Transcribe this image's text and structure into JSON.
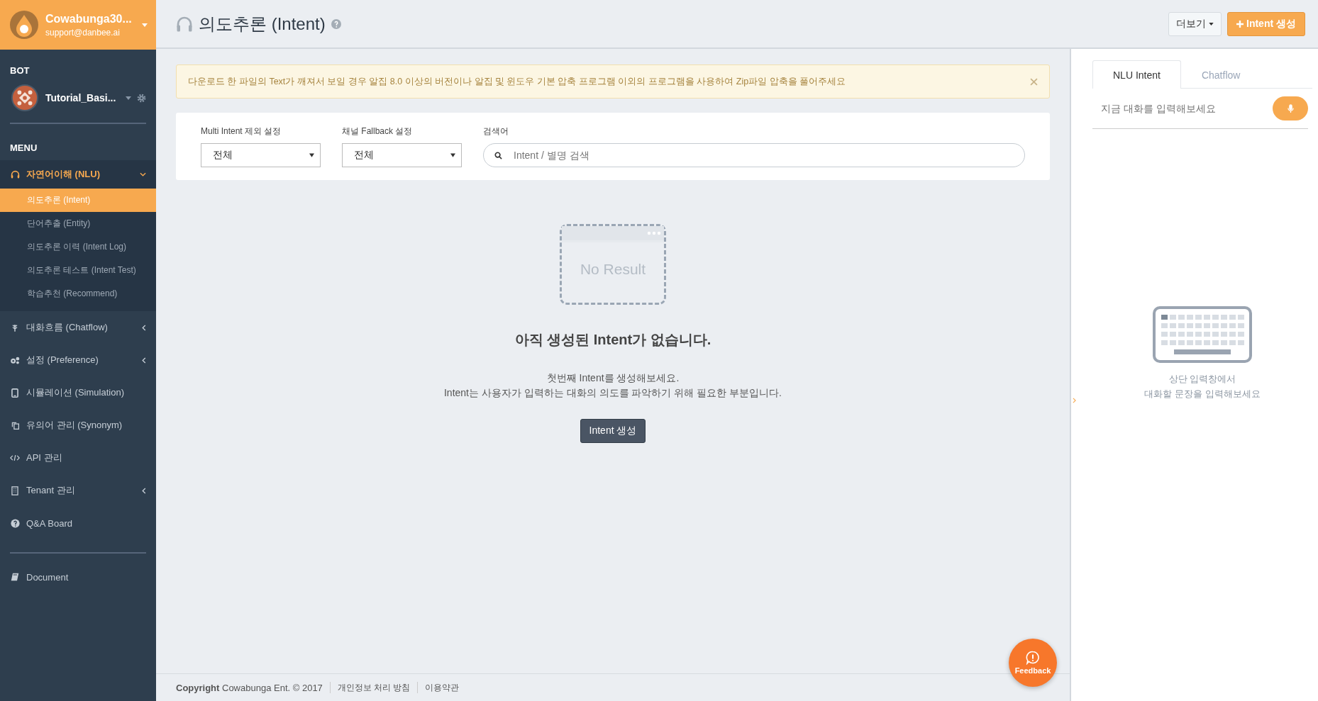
{
  "account": {
    "name": "Cowabunga30...",
    "email": "support@danbee.ai"
  },
  "bot_section": {
    "label": "BOT",
    "bot_name": "Tutorial_Basi..."
  },
  "menu": {
    "label": "MENU",
    "items": [
      {
        "label": "자연어이해 (NLU)",
        "selected": true,
        "expanded": true,
        "children": [
          {
            "label": "의도추론 (Intent)",
            "selected": true
          },
          {
            "label": "단어추출 (Entity)",
            "selected": false
          },
          {
            "label": "의도추론 이력 (Intent Log)",
            "selected": false
          },
          {
            "label": "의도추론 테스트 (Intent Test)",
            "selected": false
          },
          {
            "label": "학습추천 (Recommend)",
            "selected": false
          }
        ]
      },
      {
        "label": "대화흐름 (Chatflow)",
        "selected": false,
        "expanded": false
      },
      {
        "label": "설정 (Preference)",
        "selected": false,
        "expanded": false
      },
      {
        "label": "시뮬레이션 (Simulation)",
        "selected": false
      },
      {
        "label": "유의어 관리 (Synonym)",
        "selected": false
      },
      {
        "label": "API 관리",
        "selected": false
      },
      {
        "label": "Tenant 관리",
        "selected": false,
        "expanded": false
      },
      {
        "label": "Q&A Board",
        "selected": false
      }
    ],
    "extra_items": [
      {
        "label": "Document",
        "selected": false
      }
    ]
  },
  "page_header": {
    "title": "의도추론 (Intent)",
    "buttons": [
      {
        "label": "더보기",
        "kind": "dropdown"
      },
      {
        "label": "Intent 생성",
        "kind": "primary"
      }
    ]
  },
  "alert": {
    "text": "다운로드 한 파일의 Text가 깨져서 보일 경우 알집 8.0 이상의 버전이나 알집 및 윈도우 기본 압축 프로그램 이외의 프로그램을 사용하여 Zip파일 압축을 풀어주세요"
  },
  "filters": [
    {
      "kind": "select",
      "label": "Multi Intent 제외 설정",
      "value": "전체"
    },
    {
      "kind": "select",
      "label": "채널 Fallback 설정",
      "value": "전체"
    },
    {
      "kind": "search",
      "label": "검색어",
      "placeholder": "Intent / 별명 검색"
    }
  ],
  "empty_state": {
    "image_text": "No Result",
    "heading": "아직 생성된 Intent가 없습니다.",
    "lines": [
      "첫번째 Intent를 생성해보세요.",
      "Intent는 사용자가 입력하는 대화의 의도를 파악하기 위해 필요한 부분입니다."
    ],
    "button": "Intent 생성"
  },
  "footer": {
    "copyright": "**Copyright** Cowabunga Ent. © 2017",
    "links": [
      "개인정보 처리 방침",
      "이용약관"
    ]
  },
  "feedback": {
    "label": "Feedback"
  },
  "right_panel": {
    "tabs": [
      {
        "label": "NLU Intent",
        "selected": true
      },
      {
        "label": "Chatflow",
        "selected": false
      }
    ],
    "input": {
      "placeholder": "지금 대화를 입력해보세요"
    },
    "hint": [
      "상단 입력창에서",
      "대화할 문장을 입력해보세요"
    ]
  }
}
